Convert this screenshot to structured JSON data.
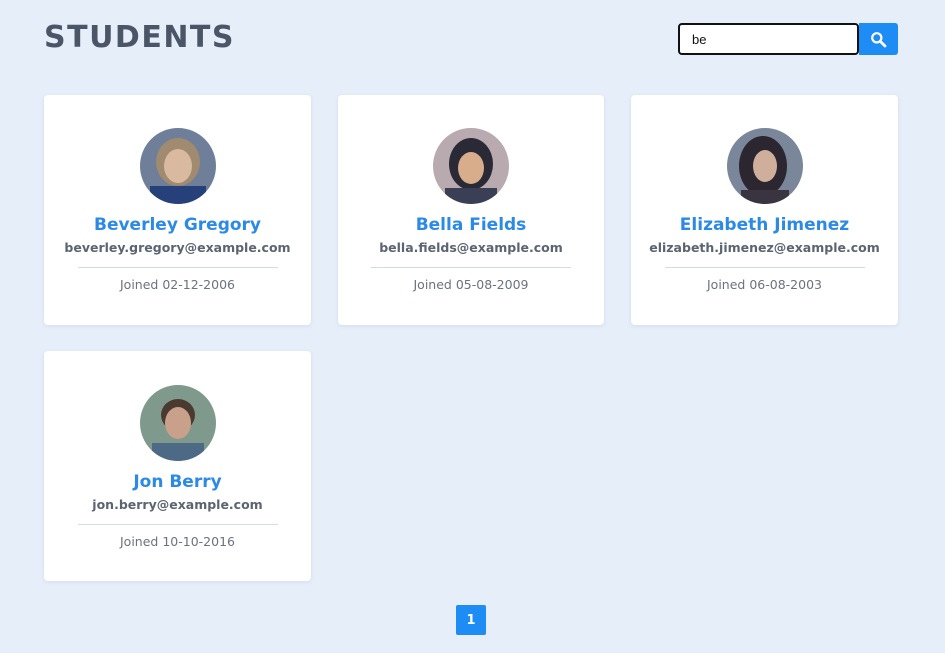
{
  "header": {
    "title": "STUDENTS"
  },
  "search": {
    "value": "be"
  },
  "students": [
    {
      "name": "Beverley Gregory",
      "email": "beverley.gregory@example.com",
      "joined": "Joined 02-12-2006"
    },
    {
      "name": "Bella Fields",
      "email": "bella.fields@example.com",
      "joined": "Joined 05-08-2009"
    },
    {
      "name": "Elizabeth Jimenez",
      "email": "elizabeth.jimenez@example.com",
      "joined": "Joined 06-08-2003"
    },
    {
      "name": "Jon Berry",
      "email": "jon.berry@example.com",
      "joined": "Joined 10-10-2016"
    }
  ],
  "pagination": {
    "current": "1"
  },
  "colors": {
    "accent": "#1e8cf5",
    "name": "#2b8ae6",
    "background": "#e6eefa",
    "title": "#4a5568"
  },
  "icons": {
    "search_button": "search-icon"
  }
}
